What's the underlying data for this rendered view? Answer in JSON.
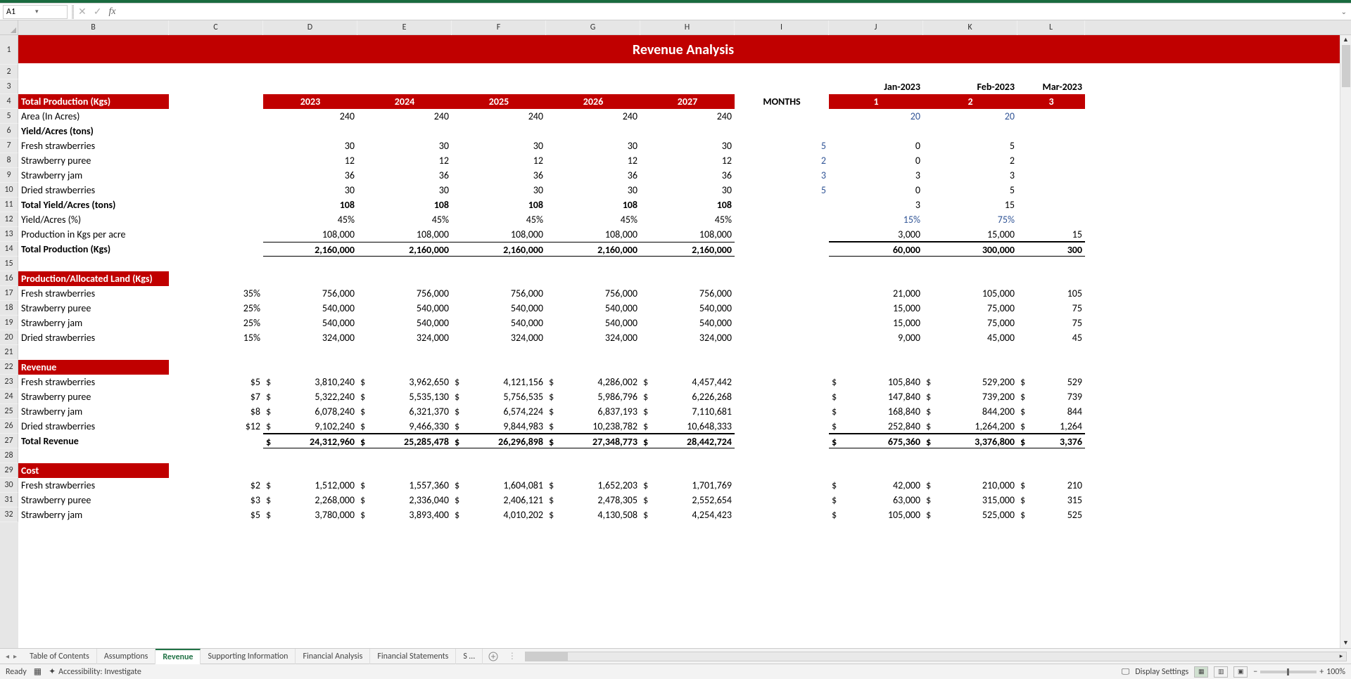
{
  "name_box": "A1",
  "title_band": "Revenue Analysis",
  "columns": [
    "B",
    "C",
    "D",
    "E",
    "F",
    "G",
    "H",
    "I",
    "J",
    "K",
    "L"
  ],
  "rows_visible": 32,
  "months_label": "MONTHS",
  "month_headers": [
    "Jan-2023",
    "Feb-2023",
    "Mar-2023"
  ],
  "month_numbers": [
    "1",
    "2",
    "3"
  ],
  "year_headers": [
    "2023",
    "2024",
    "2025",
    "2026",
    "2027"
  ],
  "sections": {
    "total_production_hdr": "Total Production (Kgs)",
    "area": {
      "label": "Area (In Acres)",
      "y": [
        "240",
        "240",
        "240",
        "240",
        "240"
      ],
      "m": [
        "20",
        "20",
        ""
      ]
    },
    "yield_header": "Yield/Acres (tons)",
    "fresh": {
      "label": "Fresh strawberries",
      "y": [
        "30",
        "30",
        "30",
        "30",
        "30"
      ],
      "i": "5",
      "m": [
        "0",
        "5",
        ""
      ]
    },
    "puree": {
      "label": "Strawberry puree",
      "y": [
        "12",
        "12",
        "12",
        "12",
        "12"
      ],
      "i": "2",
      "m": [
        "0",
        "2",
        ""
      ]
    },
    "jam": {
      "label": "Strawberry jam",
      "y": [
        "36",
        "36",
        "36",
        "36",
        "36"
      ],
      "i": "3",
      "m": [
        "3",
        "3",
        ""
      ]
    },
    "dried": {
      "label": "Dried strawberries",
      "y": [
        "30",
        "30",
        "30",
        "30",
        "30"
      ],
      "i": "5",
      "m": [
        "0",
        "5",
        ""
      ]
    },
    "total_yield": {
      "label": "Total Yield/Acres (tons)",
      "y": [
        "108",
        "108",
        "108",
        "108",
        "108"
      ],
      "m": [
        "3",
        "15",
        ""
      ]
    },
    "yield_pct": {
      "label": "Yield/Acres (%)",
      "y": [
        "45%",
        "45%",
        "45%",
        "45%",
        "45%"
      ],
      "m": [
        "15%",
        "75%",
        ""
      ]
    },
    "prod_per_acre": {
      "label": "Production in Kgs per acre",
      "y": [
        "108,000",
        "108,000",
        "108,000",
        "108,000",
        "108,000"
      ],
      "m": [
        "3,000",
        "15,000",
        "15"
      ]
    },
    "total_prod": {
      "label": "Total Production (Kgs)",
      "y": [
        "2,160,000",
        "2,160,000",
        "2,160,000",
        "2,160,000",
        "2,160,000"
      ],
      "m": [
        "60,000",
        "300,000",
        "300"
      ]
    },
    "alloc_hdr": "Production/Allocated Land (Kgs)",
    "alloc_fresh": {
      "label": "Fresh strawberries",
      "pct": "35%",
      "y": [
        "756,000",
        "756,000",
        "756,000",
        "756,000",
        "756,000"
      ],
      "m": [
        "21,000",
        "105,000",
        "105"
      ]
    },
    "alloc_puree": {
      "label": "Strawberry puree",
      "pct": "25%",
      "y": [
        "540,000",
        "540,000",
        "540,000",
        "540,000",
        "540,000"
      ],
      "m": [
        "15,000",
        "75,000",
        "75"
      ]
    },
    "alloc_jam": {
      "label": "Strawberry jam",
      "pct": "25%",
      "y": [
        "540,000",
        "540,000",
        "540,000",
        "540,000",
        "540,000"
      ],
      "m": [
        "15,000",
        "75,000",
        "75"
      ]
    },
    "alloc_dried": {
      "label": "Dried strawberries",
      "pct": "15%",
      "y": [
        "324,000",
        "324,000",
        "324,000",
        "324,000",
        "324,000"
      ],
      "m": [
        "9,000",
        "45,000",
        "45"
      ]
    },
    "revenue_hdr": "Revenue",
    "rev_fresh": {
      "label": "Fresh strawberries",
      "price": "$5",
      "y": [
        "3,810,240",
        "3,962,650",
        "4,121,156",
        "4,286,002",
        "4,457,442"
      ],
      "m": [
        "105,840",
        "529,200",
        "529"
      ]
    },
    "rev_puree": {
      "label": "Strawberry puree",
      "price": "$7",
      "y": [
        "5,322,240",
        "5,535,130",
        "5,756,535",
        "5,986,796",
        "6,226,268"
      ],
      "m": [
        "147,840",
        "739,200",
        "739"
      ]
    },
    "rev_jam": {
      "label": "Strawberry jam",
      "price": "$8",
      "y": [
        "6,078,240",
        "6,321,370",
        "6,574,224",
        "6,837,193",
        "7,110,681"
      ],
      "m": [
        "168,840",
        "844,200",
        "844"
      ]
    },
    "rev_dried": {
      "label": "Dried strawberries",
      "price": "$12",
      "y": [
        "9,102,240",
        "9,466,330",
        "9,844,983",
        "10,238,782",
        "10,648,333"
      ],
      "m": [
        "252,840",
        "1,264,200",
        "1,264"
      ]
    },
    "rev_total": {
      "label": "Total Revenue",
      "y": [
        "24,312,960",
        "25,285,478",
        "26,296,898",
        "27,348,773",
        "28,442,724"
      ],
      "m": [
        "675,360",
        "3,376,800",
        "3,376"
      ]
    },
    "cost_hdr": "Cost",
    "cost_fresh": {
      "label": "Fresh strawberries",
      "price": "$2",
      "y": [
        "1,512,000",
        "1,557,360",
        "1,604,081",
        "1,652,203",
        "1,701,769"
      ],
      "m": [
        "42,000",
        "210,000",
        "210"
      ]
    },
    "cost_puree": {
      "label": "Strawberry puree",
      "price": "$3",
      "y": [
        "2,268,000",
        "2,336,040",
        "2,406,121",
        "2,478,305",
        "2,552,654"
      ],
      "m": [
        "63,000",
        "315,000",
        "315"
      ]
    },
    "cost_jam": {
      "label": "Strawberry jam",
      "price": "$5",
      "y": [
        "3,780,000",
        "3,893,400",
        "4,010,202",
        "4,130,508",
        "4,254,423"
      ],
      "m": [
        "105,000",
        "525,000",
        "525"
      ]
    }
  },
  "tabs": [
    "Table of Contents",
    "Assumptions",
    "Revenue",
    "Supporting Information",
    "Financial Analysis",
    "Financial Statements",
    "S …"
  ],
  "active_tab": 2,
  "status": {
    "ready": "Ready",
    "accessibility": "Accessibility: Investigate",
    "display": "Display Settings",
    "zoom": "100%"
  }
}
